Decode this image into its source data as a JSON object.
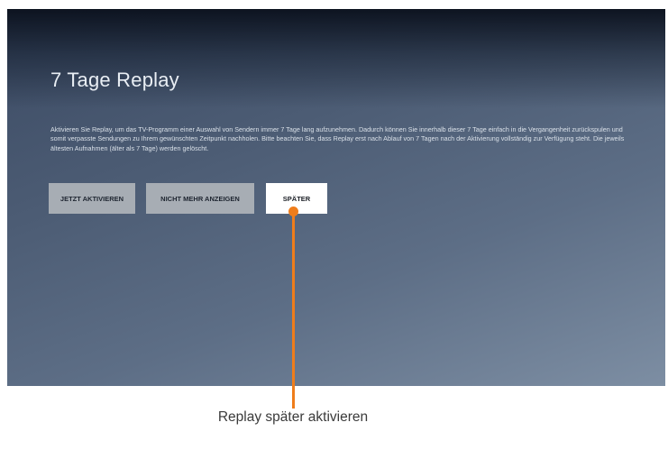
{
  "screen": {
    "title": "7 Tage Replay",
    "description": "Aktivieren Sie Replay, um das TV-Programm einer Auswahl von Sendern immer 7 Tage lang aufzunehmen. Dadurch können Sie innerhalb dieser 7 Tage einfach in die Vergangenheit zurückspulen und somit verpasste Sendungen zu Ihrem gewünschten Zeitpunkt nachholen. Bitte beachten Sie, dass Replay erst nach Ablauf von 7 Tagen nach der Aktivierung vollständig zur Verfügung steht. Die jeweils ältesten Aufnahmen (älter als 7 Tage) werden gelöscht.",
    "buttons": {
      "activate": "JETZT AKTIVIEREN",
      "never": "NICHT MEHR ANZEIGEN",
      "later": "SPÄTER"
    }
  },
  "callout": {
    "text": "Replay später aktivieren",
    "color": "#ef7d1b"
  }
}
